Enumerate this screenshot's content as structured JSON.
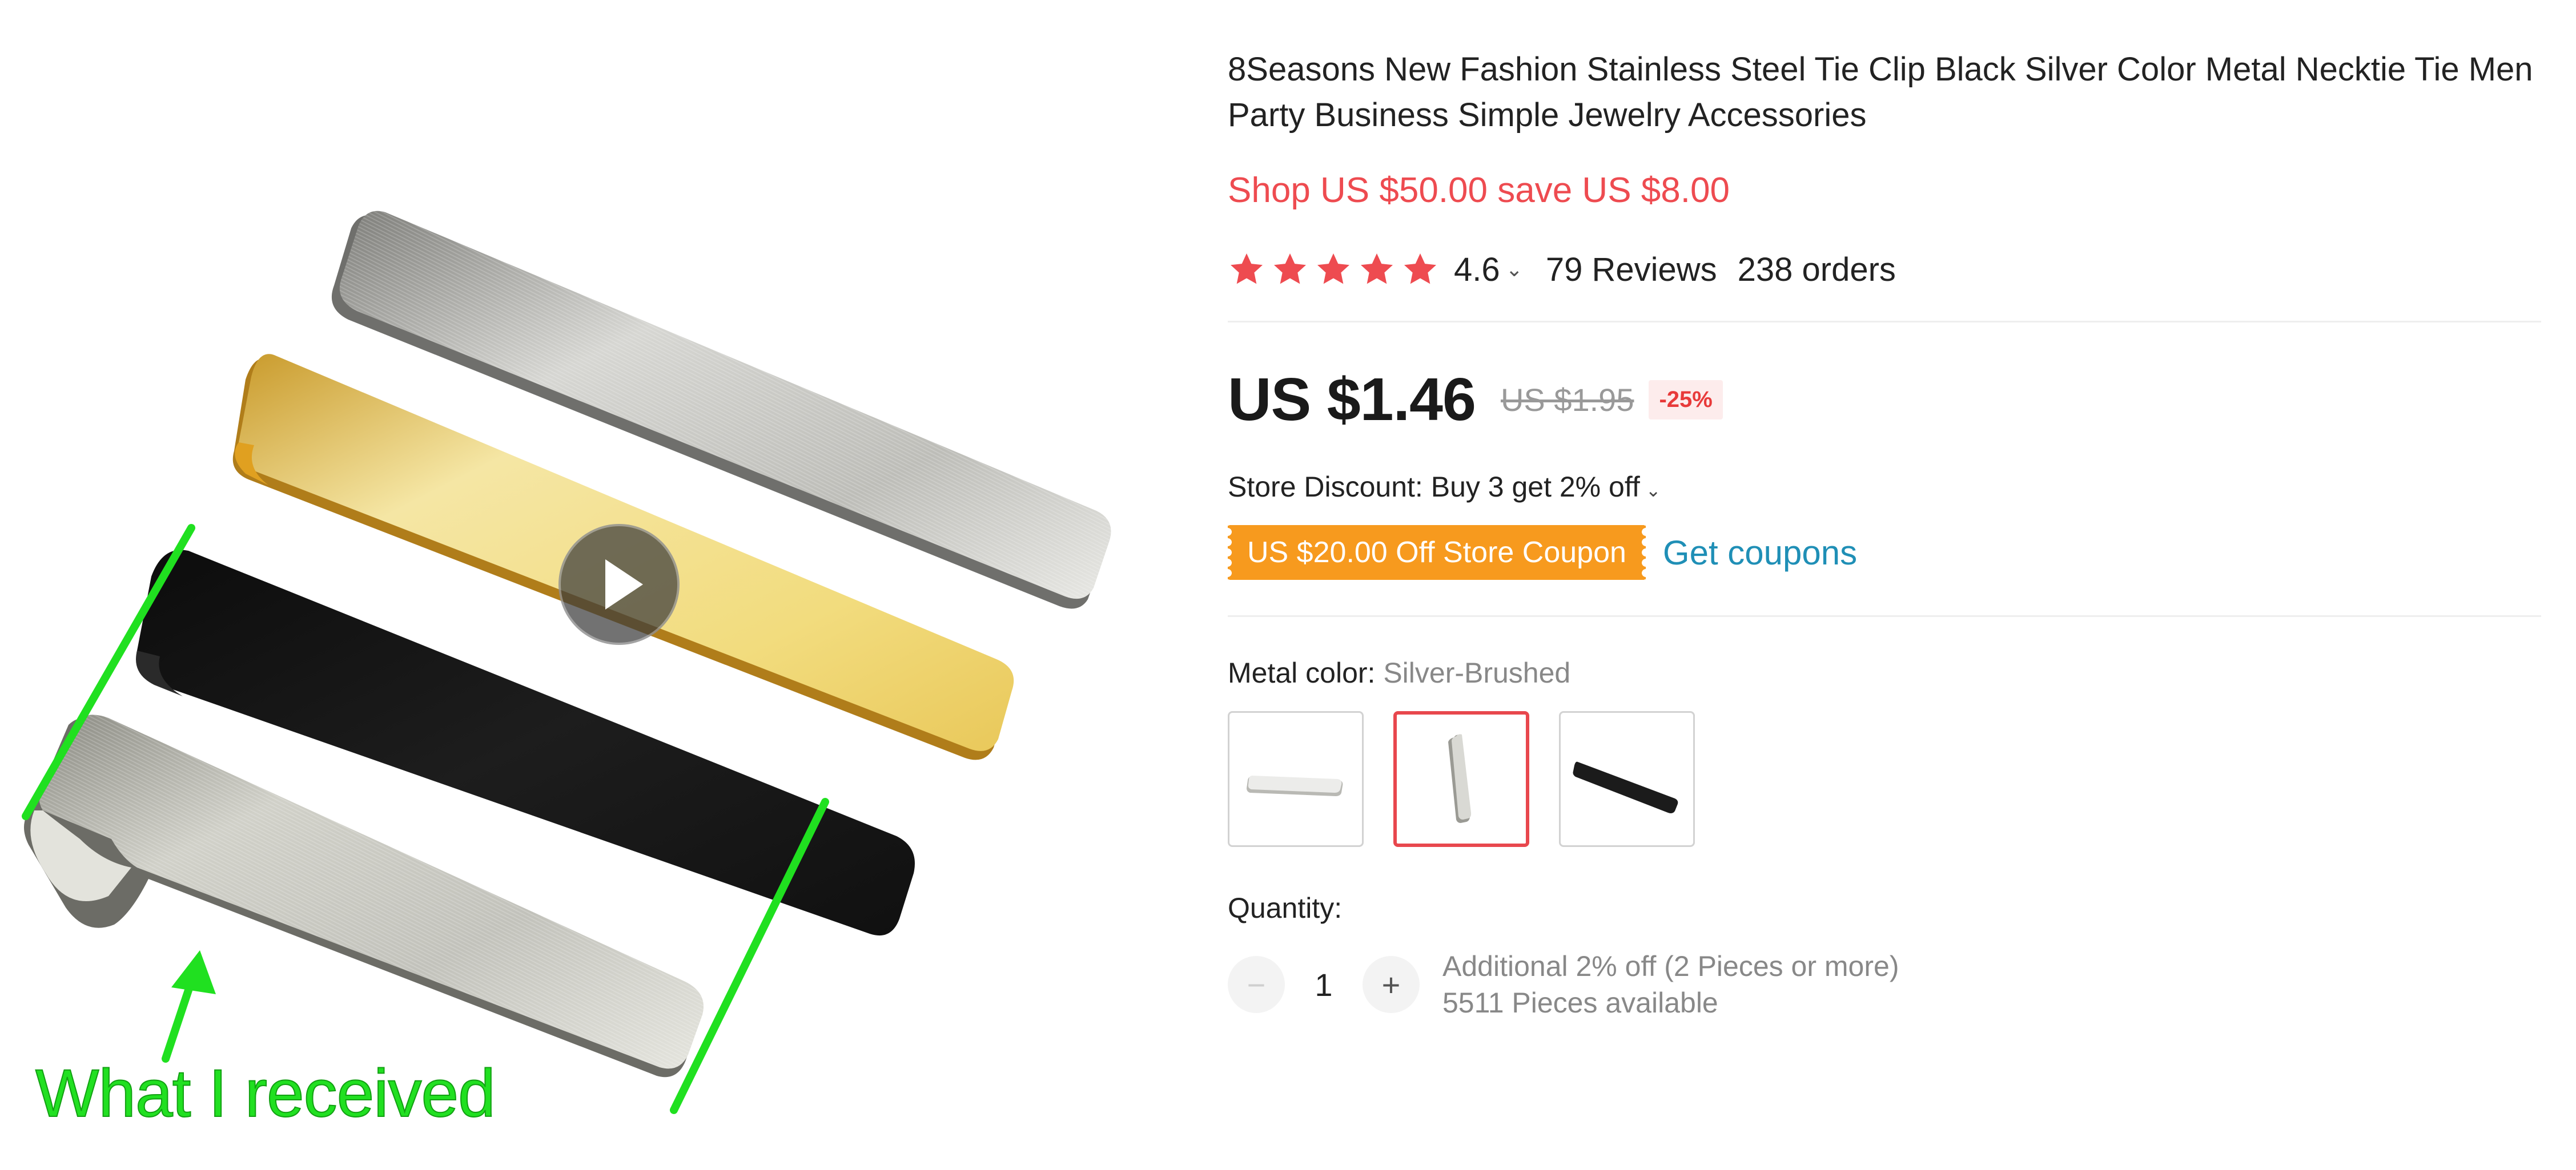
{
  "product": {
    "title": "8Seasons New Fashion Stainless Steel Tie Clip Black Silver Color Metal Necktie Tie Men Party Business Simple Jewelry Accessories",
    "shop_promo": "Shop US $50.00 save US $8.00",
    "rating": {
      "stars": 5,
      "value": "4.6",
      "caret": "⌄",
      "reviews": "79 Reviews",
      "orders": "238 orders",
      "star_color": "#ee4b50"
    },
    "price": {
      "current": "US $1.46",
      "original": "US $1.95",
      "discount": "-25%"
    },
    "store_discount": {
      "text": "Store Discount: Buy 3 get 2% off",
      "caret": "⌄"
    },
    "coupon": {
      "label": "US $20.00 Off Store Coupon",
      "link": "Get coupons",
      "color": "#f79a1e",
      "link_color": "#1f8fb6"
    },
    "variant": {
      "label": "Metal color: ",
      "selected": "Silver-Brushed",
      "options": [
        "silver-polished",
        "silver-brushed",
        "black"
      ],
      "selected_index": 1,
      "highlight_color": "#e8474d"
    },
    "quantity": {
      "label": "Quantity:",
      "minus": "−",
      "plus": "+",
      "value": "1",
      "additional": "Additional 2% off (2 Pieces or more)",
      "available": "5511 Pieces available"
    }
  },
  "media": {
    "play_icon": "play-icon",
    "annotation_text": "What I received",
    "annotation_color": "#21e021",
    "items": [
      "silver-brushed-tie-clip",
      "gold-tie-clip",
      "black-tie-clip",
      "silver-brushed-tie-clip-received"
    ]
  }
}
